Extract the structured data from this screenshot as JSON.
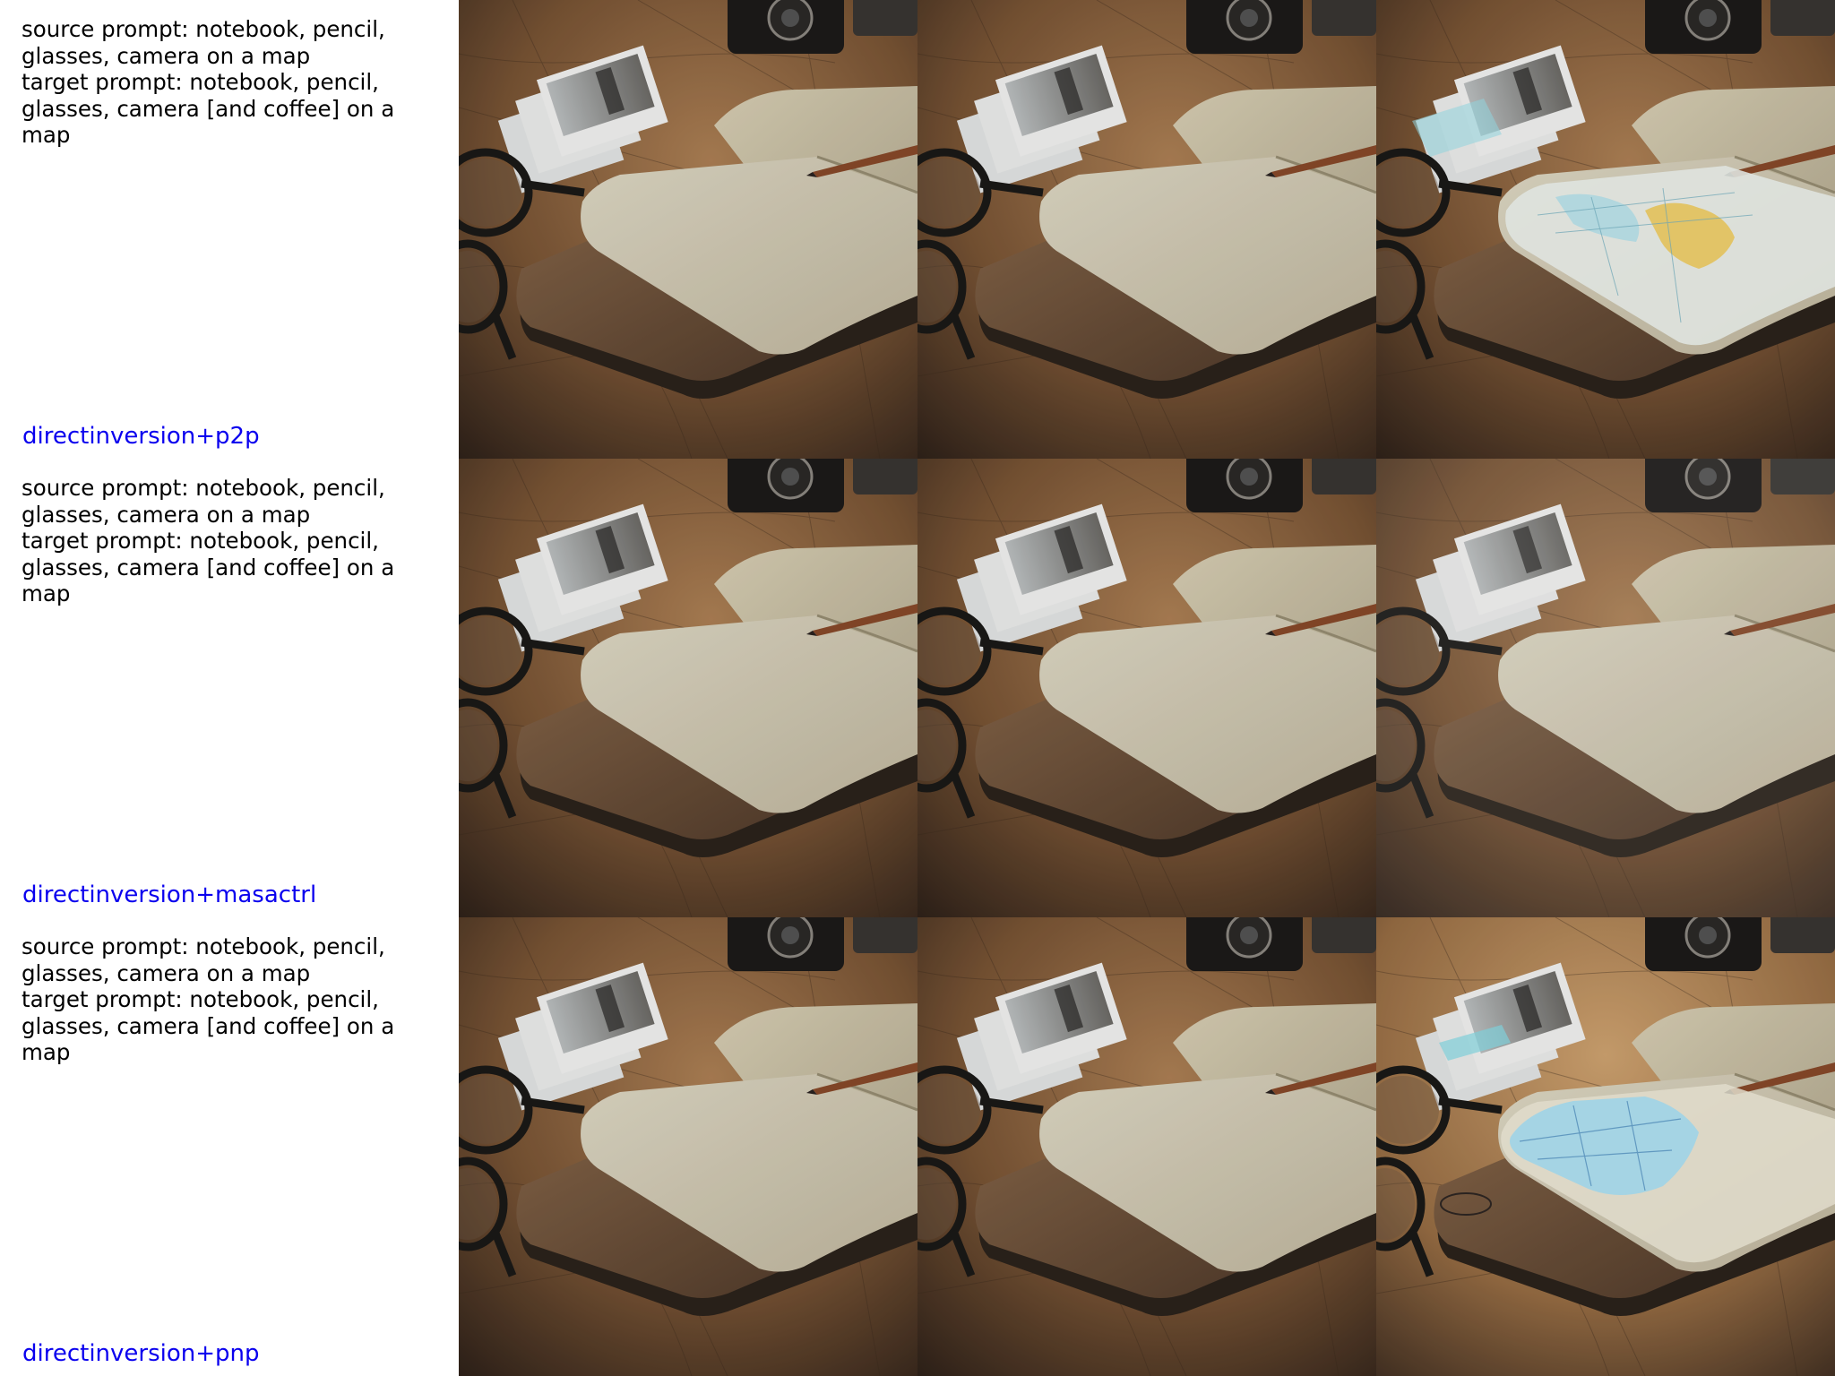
{
  "accent_color": "#0a00ee",
  "rows": [
    {
      "source_prompt": "source prompt: notebook, pencil, glasses, camera on a map",
      "target_prompt": "target prompt: notebook, pencil, glasses, camera [and coffee] on a map",
      "method": "directinversion+p2p",
      "images": [
        {
          "variant": "plain"
        },
        {
          "variant": "plain"
        },
        {
          "variant": "mapped",
          "page_map": "yellow-blue"
        }
      ]
    },
    {
      "source_prompt": "source prompt: notebook, pencil, glasses, camera on a map",
      "target_prompt": "target prompt: notebook, pencil, glasses, camera [and coffee] on a map",
      "method": "directinversion+masactrl",
      "images": [
        {
          "variant": "plain"
        },
        {
          "variant": "plain"
        },
        {
          "variant": "plain-soft"
        }
      ]
    },
    {
      "source_prompt": "source prompt: notebook, pencil, glasses, camera on a map",
      "target_prompt": "target prompt: notebook, pencil, glasses, camera [and coffee] on a map",
      "method": "directinversion+pnp",
      "images": [
        {
          "variant": "plain"
        },
        {
          "variant": "plain"
        },
        {
          "variant": "mapped",
          "page_map": "blue"
        }
      ]
    }
  ]
}
